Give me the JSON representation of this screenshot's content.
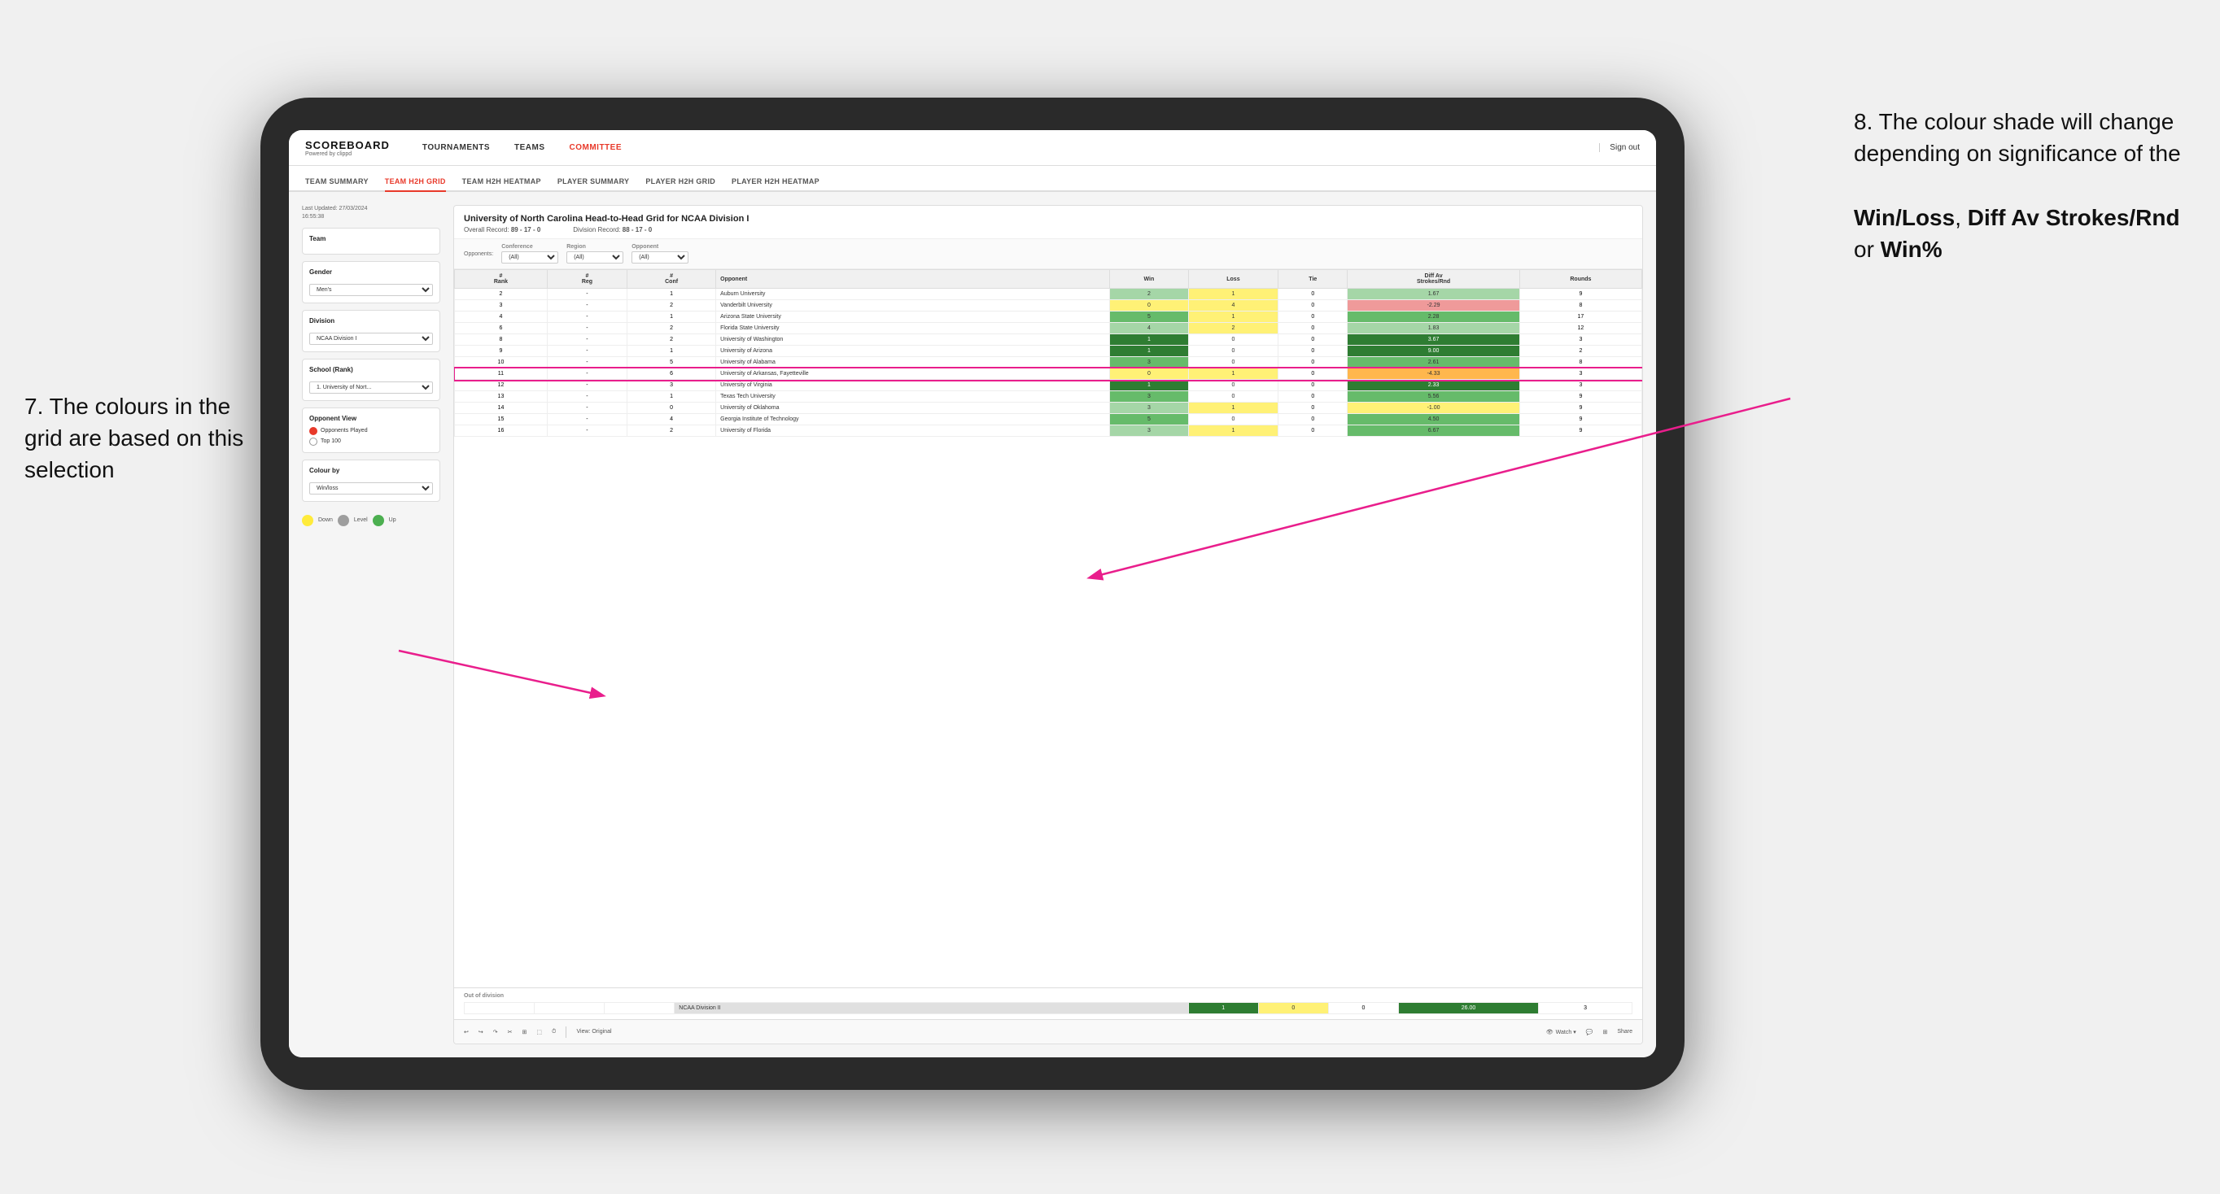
{
  "annotations": {
    "left_text": "7. The colours in the grid are based on this selection",
    "right_title": "8. The colour shade will change depending on significance of the",
    "right_bold1": "Win/Loss",
    "right_bold2": "Diff Av Strokes/Rnd",
    "right_bold3": "Win%",
    "right_connector": " or "
  },
  "nav": {
    "logo": "SCOREBOARD",
    "logo_sub": "Powered by clippd",
    "links": [
      "TOURNAMENTS",
      "TEAMS",
      "COMMITTEE"
    ],
    "active_link": "COMMITTEE",
    "sign_out": "Sign out"
  },
  "sub_tabs": [
    "TEAM SUMMARY",
    "TEAM H2H GRID",
    "TEAM H2H HEATMAP",
    "PLAYER SUMMARY",
    "PLAYER H2H GRID",
    "PLAYER H2H HEATMAP"
  ],
  "active_sub_tab": "TEAM H2H GRID",
  "sidebar": {
    "last_updated_label": "Last Updated: 27/03/2024",
    "last_updated_time": "16:55:38",
    "team_label": "Team",
    "gender_label": "Gender",
    "gender_value": "Men's",
    "division_label": "Division",
    "division_value": "NCAA Division I",
    "school_label": "School (Rank)",
    "school_value": "1. University of Nort...",
    "opponent_view_label": "Opponent View",
    "radio_options": [
      "Opponents Played",
      "Top 100"
    ],
    "selected_radio": "Opponents Played",
    "colour_by_label": "Colour by",
    "colour_by_value": "Win/loss",
    "legend": [
      {
        "color": "#ffeb3b",
        "label": "Down"
      },
      {
        "color": "#9e9e9e",
        "label": "Level"
      },
      {
        "color": "#4caf50",
        "label": "Up"
      }
    ]
  },
  "grid": {
    "title": "University of North Carolina Head-to-Head Grid for NCAA Division I",
    "overall_record_label": "Overall Record:",
    "overall_record": "89 - 17 - 0",
    "division_record_label": "Division Record:",
    "division_record": "88 - 17 - 0",
    "filters": {
      "conference_label": "Conference",
      "conference_value": "(All)",
      "region_label": "Region",
      "region_value": "(All)",
      "opponent_label": "Opponent",
      "opponent_value": "(All)"
    },
    "col_headers": [
      "#\nRank",
      "#\nReg",
      "#\nConf",
      "Opponent",
      "Win",
      "Loss",
      "Tie",
      "Diff Av\nStrokes/Rnd",
      "Rounds"
    ],
    "rows": [
      {
        "rank": "2",
        "reg": "-",
        "conf": "1",
        "opponent": "Auburn University",
        "win": "2",
        "loss": "1",
        "tie": "0",
        "diff": "1.67",
        "rounds": "9",
        "win_color": "cell-green-light",
        "diff_color": "cell-green-light"
      },
      {
        "rank": "3",
        "reg": "-",
        "conf": "2",
        "opponent": "Vanderbilt University",
        "win": "0",
        "loss": "4",
        "tie": "0",
        "diff": "-2.29",
        "rounds": "8",
        "win_color": "cell-yellow",
        "diff_color": "cell-red-light"
      },
      {
        "rank": "4",
        "reg": "-",
        "conf": "1",
        "opponent": "Arizona State University",
        "win": "5",
        "loss": "1",
        "tie": "0",
        "diff": "2.28",
        "rounds": "17",
        "win_color": "cell-green-mid",
        "diff_color": "cell-green-mid"
      },
      {
        "rank": "6",
        "reg": "-",
        "conf": "2",
        "opponent": "Florida State University",
        "win": "4",
        "loss": "2",
        "tie": "0",
        "diff": "1.83",
        "rounds": "12",
        "win_color": "cell-green-light",
        "diff_color": "cell-green-light"
      },
      {
        "rank": "8",
        "reg": "-",
        "conf": "2",
        "opponent": "University of Washington",
        "win": "1",
        "loss": "0",
        "tie": "0",
        "diff": "3.67",
        "rounds": "3",
        "win_color": "cell-green-dark",
        "diff_color": "cell-green-dark"
      },
      {
        "rank": "9",
        "reg": "-",
        "conf": "1",
        "opponent": "University of Arizona",
        "win": "1",
        "loss": "0",
        "tie": "0",
        "diff": "9.00",
        "rounds": "2",
        "win_color": "cell-green-dark",
        "diff_color": "cell-green-dark"
      },
      {
        "rank": "10",
        "reg": "-",
        "conf": "5",
        "opponent": "University of Alabama",
        "win": "3",
        "loss": "0",
        "tie": "0",
        "diff": "2.61",
        "rounds": "8",
        "win_color": "cell-green-mid",
        "diff_color": "cell-green-mid"
      },
      {
        "rank": "11",
        "reg": "-",
        "conf": "6",
        "opponent": "University of Arkansas, Fayetteville",
        "win": "0",
        "loss": "1",
        "tie": "0",
        "diff": "-4.33",
        "rounds": "3",
        "win_color": "cell-yellow",
        "diff_color": "cell-orange"
      },
      {
        "rank": "12",
        "reg": "-",
        "conf": "3",
        "opponent": "University of Virginia",
        "win": "1",
        "loss": "0",
        "tie": "0",
        "diff": "2.33",
        "rounds": "3",
        "win_color": "cell-green-dark",
        "diff_color": "cell-green-dark"
      },
      {
        "rank": "13",
        "reg": "-",
        "conf": "1",
        "opponent": "Texas Tech University",
        "win": "3",
        "loss": "0",
        "tie": "0",
        "diff": "5.56",
        "rounds": "9",
        "win_color": "cell-green-mid",
        "diff_color": "cell-green-mid"
      },
      {
        "rank": "14",
        "reg": "-",
        "conf": "0",
        "opponent": "University of Oklahoma",
        "win": "3",
        "loss": "1",
        "tie": "0",
        "diff": "-1.00",
        "rounds": "9",
        "win_color": "cell-green-light",
        "diff_color": "cell-yellow"
      },
      {
        "rank": "15",
        "reg": "-",
        "conf": "4",
        "opponent": "Georgia Institute of Technology",
        "win": "5",
        "loss": "0",
        "tie": "0",
        "diff": "4.50",
        "rounds": "9",
        "win_color": "cell-green-mid",
        "diff_color": "cell-green-mid"
      },
      {
        "rank": "16",
        "reg": "-",
        "conf": "2",
        "opponent": "University of Florida",
        "win": "3",
        "loss": "1",
        "tie": "0",
        "diff": "6.67",
        "rounds": "9",
        "win_color": "cell-green-light",
        "diff_color": "cell-green-mid"
      }
    ],
    "out_of_division_label": "Out of division",
    "out_of_division_row": {
      "division": "NCAA Division II",
      "win": "1",
      "loss": "0",
      "tie": "0",
      "diff": "26.00",
      "rounds": "3",
      "diff_color": "cell-green-dark"
    }
  },
  "toolbar": {
    "view_label": "View: Original",
    "watch_label": "Watch ▾",
    "share_label": "Share"
  }
}
